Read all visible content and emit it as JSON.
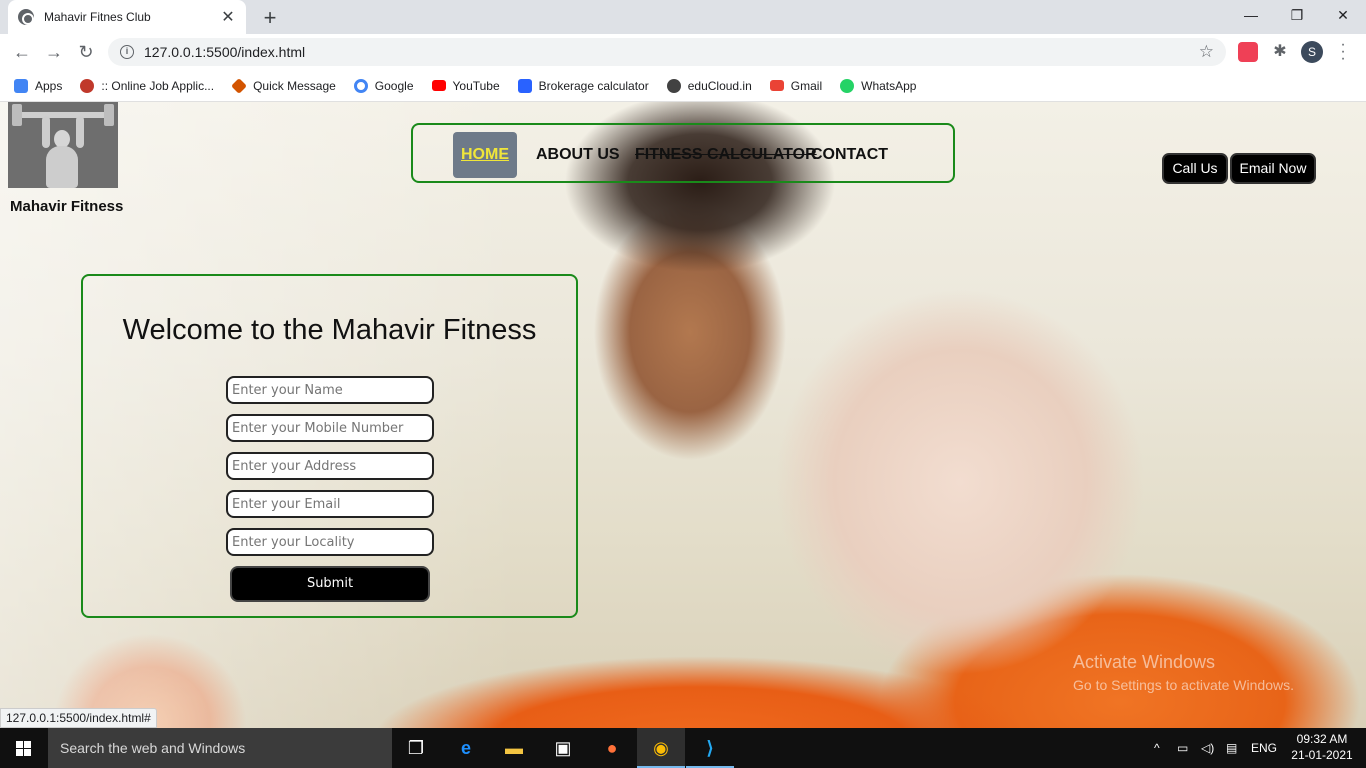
{
  "browser": {
    "tab_title": "Mahavir Fitnes Club",
    "tab_close": "✕",
    "new_tab": "+",
    "url": "127.0.0.1:5500/index.html",
    "profile_initial": "S",
    "window_controls": {
      "minimize": "—",
      "restore": "❐",
      "close": "✕"
    }
  },
  "bookmarks": [
    {
      "label": "Apps",
      "color": "#4285f4"
    },
    {
      "label": ":: Online Job Applic...",
      "color": "#c0392b"
    },
    {
      "label": "Quick Message",
      "color": "#d35400"
    },
    {
      "label": "Google",
      "color": "#4285f4"
    },
    {
      "label": "YouTube",
      "color": "#ff0000"
    },
    {
      "label": "Brokerage calculator",
      "color": "#2962ff"
    },
    {
      "label": "eduCloud.in",
      "color": "#424242"
    },
    {
      "label": "Gmail",
      "color": "#ea4335"
    },
    {
      "label": "WhatsApp",
      "color": "#25d366"
    }
  ],
  "site": {
    "brand": "Mahavir Fitness",
    "nav": {
      "home": "HOME",
      "about": "ABOUT US",
      "calculator": "FITNESS CALCULATOR",
      "contact": "CONTACT"
    },
    "call_us": "Call Us",
    "email_now": "Email Now",
    "form": {
      "heading": "Welcome to the Mahavir Fitness",
      "name_placeholder": "Enter your Name",
      "mobile_placeholder": "Enter your Mobile Number",
      "address_placeholder": "Enter your Address",
      "email_placeholder": "Enter your Email",
      "locality_placeholder": "Enter your Locality",
      "submit": "Submit"
    }
  },
  "status_link": "127.0.0.1:5500/index.html#",
  "watermark": {
    "line1": "Activate Windows",
    "line2": "Go to Settings to activate Windows."
  },
  "taskbar": {
    "search_placeholder": "Search the web and Windows",
    "language": "ENG",
    "time": "09:32 AM",
    "date": "21-01-2021"
  },
  "colors": {
    "nav_border": "#1a8a1a",
    "home_active_bg": "#6e7a89",
    "home_active_text": "#f0e63a"
  }
}
